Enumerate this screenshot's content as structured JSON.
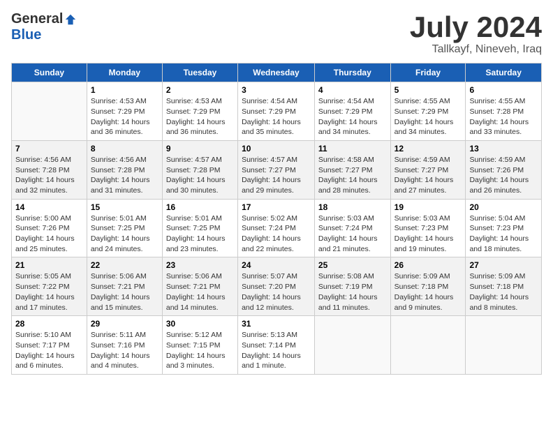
{
  "logo": {
    "general": "General",
    "blue": "Blue"
  },
  "title": {
    "month_year": "July 2024",
    "location": "Tallkayf, Nineveh, Iraq"
  },
  "days_of_week": [
    "Sunday",
    "Monday",
    "Tuesday",
    "Wednesday",
    "Thursday",
    "Friday",
    "Saturday"
  ],
  "weeks": [
    [
      {
        "day": "",
        "sunrise": "",
        "sunset": "",
        "daylight": "",
        "empty": true
      },
      {
        "day": "1",
        "sunrise": "Sunrise: 4:53 AM",
        "sunset": "Sunset: 7:29 PM",
        "daylight": "Daylight: 14 hours and 36 minutes."
      },
      {
        "day": "2",
        "sunrise": "Sunrise: 4:53 AM",
        "sunset": "Sunset: 7:29 PM",
        "daylight": "Daylight: 14 hours and 36 minutes."
      },
      {
        "day": "3",
        "sunrise": "Sunrise: 4:54 AM",
        "sunset": "Sunset: 7:29 PM",
        "daylight": "Daylight: 14 hours and 35 minutes."
      },
      {
        "day": "4",
        "sunrise": "Sunrise: 4:54 AM",
        "sunset": "Sunset: 7:29 PM",
        "daylight": "Daylight: 14 hours and 34 minutes."
      },
      {
        "day": "5",
        "sunrise": "Sunrise: 4:55 AM",
        "sunset": "Sunset: 7:29 PM",
        "daylight": "Daylight: 14 hours and 34 minutes."
      },
      {
        "day": "6",
        "sunrise": "Sunrise: 4:55 AM",
        "sunset": "Sunset: 7:28 PM",
        "daylight": "Daylight: 14 hours and 33 minutes."
      }
    ],
    [
      {
        "day": "7",
        "sunrise": "Sunrise: 4:56 AM",
        "sunset": "Sunset: 7:28 PM",
        "daylight": "Daylight: 14 hours and 32 minutes."
      },
      {
        "day": "8",
        "sunrise": "Sunrise: 4:56 AM",
        "sunset": "Sunset: 7:28 PM",
        "daylight": "Daylight: 14 hours and 31 minutes."
      },
      {
        "day": "9",
        "sunrise": "Sunrise: 4:57 AM",
        "sunset": "Sunset: 7:28 PM",
        "daylight": "Daylight: 14 hours and 30 minutes."
      },
      {
        "day": "10",
        "sunrise": "Sunrise: 4:57 AM",
        "sunset": "Sunset: 7:27 PM",
        "daylight": "Daylight: 14 hours and 29 minutes."
      },
      {
        "day": "11",
        "sunrise": "Sunrise: 4:58 AM",
        "sunset": "Sunset: 7:27 PM",
        "daylight": "Daylight: 14 hours and 28 minutes."
      },
      {
        "day": "12",
        "sunrise": "Sunrise: 4:59 AM",
        "sunset": "Sunset: 7:27 PM",
        "daylight": "Daylight: 14 hours and 27 minutes."
      },
      {
        "day": "13",
        "sunrise": "Sunrise: 4:59 AM",
        "sunset": "Sunset: 7:26 PM",
        "daylight": "Daylight: 14 hours and 26 minutes."
      }
    ],
    [
      {
        "day": "14",
        "sunrise": "Sunrise: 5:00 AM",
        "sunset": "Sunset: 7:26 PM",
        "daylight": "Daylight: 14 hours and 25 minutes."
      },
      {
        "day": "15",
        "sunrise": "Sunrise: 5:01 AM",
        "sunset": "Sunset: 7:25 PM",
        "daylight": "Daylight: 14 hours and 24 minutes."
      },
      {
        "day": "16",
        "sunrise": "Sunrise: 5:01 AM",
        "sunset": "Sunset: 7:25 PM",
        "daylight": "Daylight: 14 hours and 23 minutes."
      },
      {
        "day": "17",
        "sunrise": "Sunrise: 5:02 AM",
        "sunset": "Sunset: 7:24 PM",
        "daylight": "Daylight: 14 hours and 22 minutes."
      },
      {
        "day": "18",
        "sunrise": "Sunrise: 5:03 AM",
        "sunset": "Sunset: 7:24 PM",
        "daylight": "Daylight: 14 hours and 21 minutes."
      },
      {
        "day": "19",
        "sunrise": "Sunrise: 5:03 AM",
        "sunset": "Sunset: 7:23 PM",
        "daylight": "Daylight: 14 hours and 19 minutes."
      },
      {
        "day": "20",
        "sunrise": "Sunrise: 5:04 AM",
        "sunset": "Sunset: 7:23 PM",
        "daylight": "Daylight: 14 hours and 18 minutes."
      }
    ],
    [
      {
        "day": "21",
        "sunrise": "Sunrise: 5:05 AM",
        "sunset": "Sunset: 7:22 PM",
        "daylight": "Daylight: 14 hours and 17 minutes."
      },
      {
        "day": "22",
        "sunrise": "Sunrise: 5:06 AM",
        "sunset": "Sunset: 7:21 PM",
        "daylight": "Daylight: 14 hours and 15 minutes."
      },
      {
        "day": "23",
        "sunrise": "Sunrise: 5:06 AM",
        "sunset": "Sunset: 7:21 PM",
        "daylight": "Daylight: 14 hours and 14 minutes."
      },
      {
        "day": "24",
        "sunrise": "Sunrise: 5:07 AM",
        "sunset": "Sunset: 7:20 PM",
        "daylight": "Daylight: 14 hours and 12 minutes."
      },
      {
        "day": "25",
        "sunrise": "Sunrise: 5:08 AM",
        "sunset": "Sunset: 7:19 PM",
        "daylight": "Daylight: 14 hours and 11 minutes."
      },
      {
        "day": "26",
        "sunrise": "Sunrise: 5:09 AM",
        "sunset": "Sunset: 7:18 PM",
        "daylight": "Daylight: 14 hours and 9 minutes."
      },
      {
        "day": "27",
        "sunrise": "Sunrise: 5:09 AM",
        "sunset": "Sunset: 7:18 PM",
        "daylight": "Daylight: 14 hours and 8 minutes."
      }
    ],
    [
      {
        "day": "28",
        "sunrise": "Sunrise: 5:10 AM",
        "sunset": "Sunset: 7:17 PM",
        "daylight": "Daylight: 14 hours and 6 minutes."
      },
      {
        "day": "29",
        "sunrise": "Sunrise: 5:11 AM",
        "sunset": "Sunset: 7:16 PM",
        "daylight": "Daylight: 14 hours and 4 minutes."
      },
      {
        "day": "30",
        "sunrise": "Sunrise: 5:12 AM",
        "sunset": "Sunset: 7:15 PM",
        "daylight": "Daylight: 14 hours and 3 minutes."
      },
      {
        "day": "31",
        "sunrise": "Sunrise: 5:13 AM",
        "sunset": "Sunset: 7:14 PM",
        "daylight": "Daylight: 14 hours and 1 minute."
      },
      {
        "day": "",
        "sunrise": "",
        "sunset": "",
        "daylight": "",
        "empty": true
      },
      {
        "day": "",
        "sunrise": "",
        "sunset": "",
        "daylight": "",
        "empty": true
      },
      {
        "day": "",
        "sunrise": "",
        "sunset": "",
        "daylight": "",
        "empty": true
      }
    ]
  ]
}
